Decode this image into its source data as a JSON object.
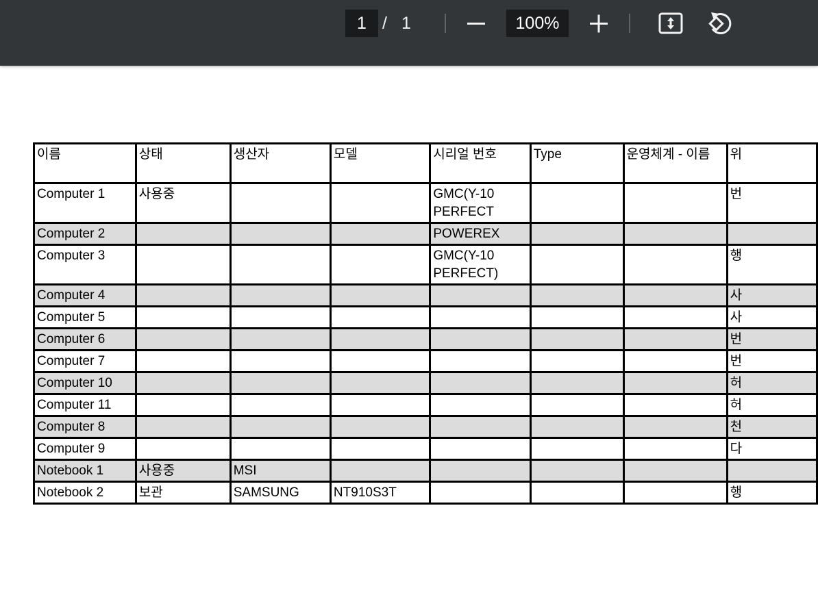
{
  "toolbar": {
    "current_page": "1",
    "page_separator": "/",
    "total_pages": "1",
    "zoom_level": "100%",
    "zoom_out_icon": "minus-icon",
    "zoom_in_icon": "plus-icon",
    "fit_icon": "fit-to-page-icon",
    "rotate_icon": "rotate-counterclockwise-icon",
    "background": "#323639"
  },
  "table": {
    "headers": [
      "이름",
      "상태",
      "생산자",
      "모델",
      "시리얼 번호",
      "Type",
      "운영체계 - 이름",
      "위"
    ],
    "rows": [
      {
        "cells": [
          "Computer 1",
          "사용중",
          "",
          "",
          "GMC(Y-10|PERFECT",
          "",
          "",
          "번"
        ],
        "shaded": false,
        "tall": true
      },
      {
        "cells": [
          "Computer 2",
          "",
          "",
          "",
          "POWEREX",
          "",
          "",
          ""
        ],
        "shaded": true,
        "tall": false
      },
      {
        "cells": [
          "Computer 3",
          "",
          "",
          "",
          "GMC(Y-10|PERFECT)",
          "",
          "",
          "행"
        ],
        "shaded": false,
        "tall": true
      },
      {
        "cells": [
          "Computer 4",
          "",
          "",
          "",
          "",
          "",
          "",
          "사"
        ],
        "shaded": true,
        "tall": false
      },
      {
        "cells": [
          "Computer 5",
          "",
          "",
          "",
          "",
          "",
          "",
          "사"
        ],
        "shaded": false,
        "tall": false
      },
      {
        "cells": [
          "Computer 6",
          "",
          "",
          "",
          "",
          "",
          "",
          "번"
        ],
        "shaded": true,
        "tall": false
      },
      {
        "cells": [
          "Computer 7",
          "",
          "",
          "",
          "",
          "",
          "",
          "번"
        ],
        "shaded": false,
        "tall": false
      },
      {
        "cells": [
          "Computer 10",
          "",
          "",
          "",
          "",
          "",
          "",
          "허"
        ],
        "shaded": true,
        "tall": false
      },
      {
        "cells": [
          "Computer 11",
          "",
          "",
          "",
          "",
          "",
          "",
          "허"
        ],
        "shaded": false,
        "tall": false
      },
      {
        "cells": [
          "Computer 8",
          "",
          "",
          "",
          "",
          "",
          "",
          "천"
        ],
        "shaded": true,
        "tall": false
      },
      {
        "cells": [
          "Computer 9",
          "",
          "",
          "",
          "",
          "",
          "",
          "다"
        ],
        "shaded": false,
        "tall": false
      },
      {
        "cells": [
          "Notebook 1",
          "사용중",
          "MSI",
          "",
          "",
          "",
          "",
          ""
        ],
        "shaded": true,
        "tall": false
      },
      {
        "cells": [
          "Notebook 2",
          "보관",
          "SAMSUNG",
          "NT910S3T",
          "",
          "",
          "",
          "행"
        ],
        "shaded": false,
        "tall": false
      }
    ]
  }
}
